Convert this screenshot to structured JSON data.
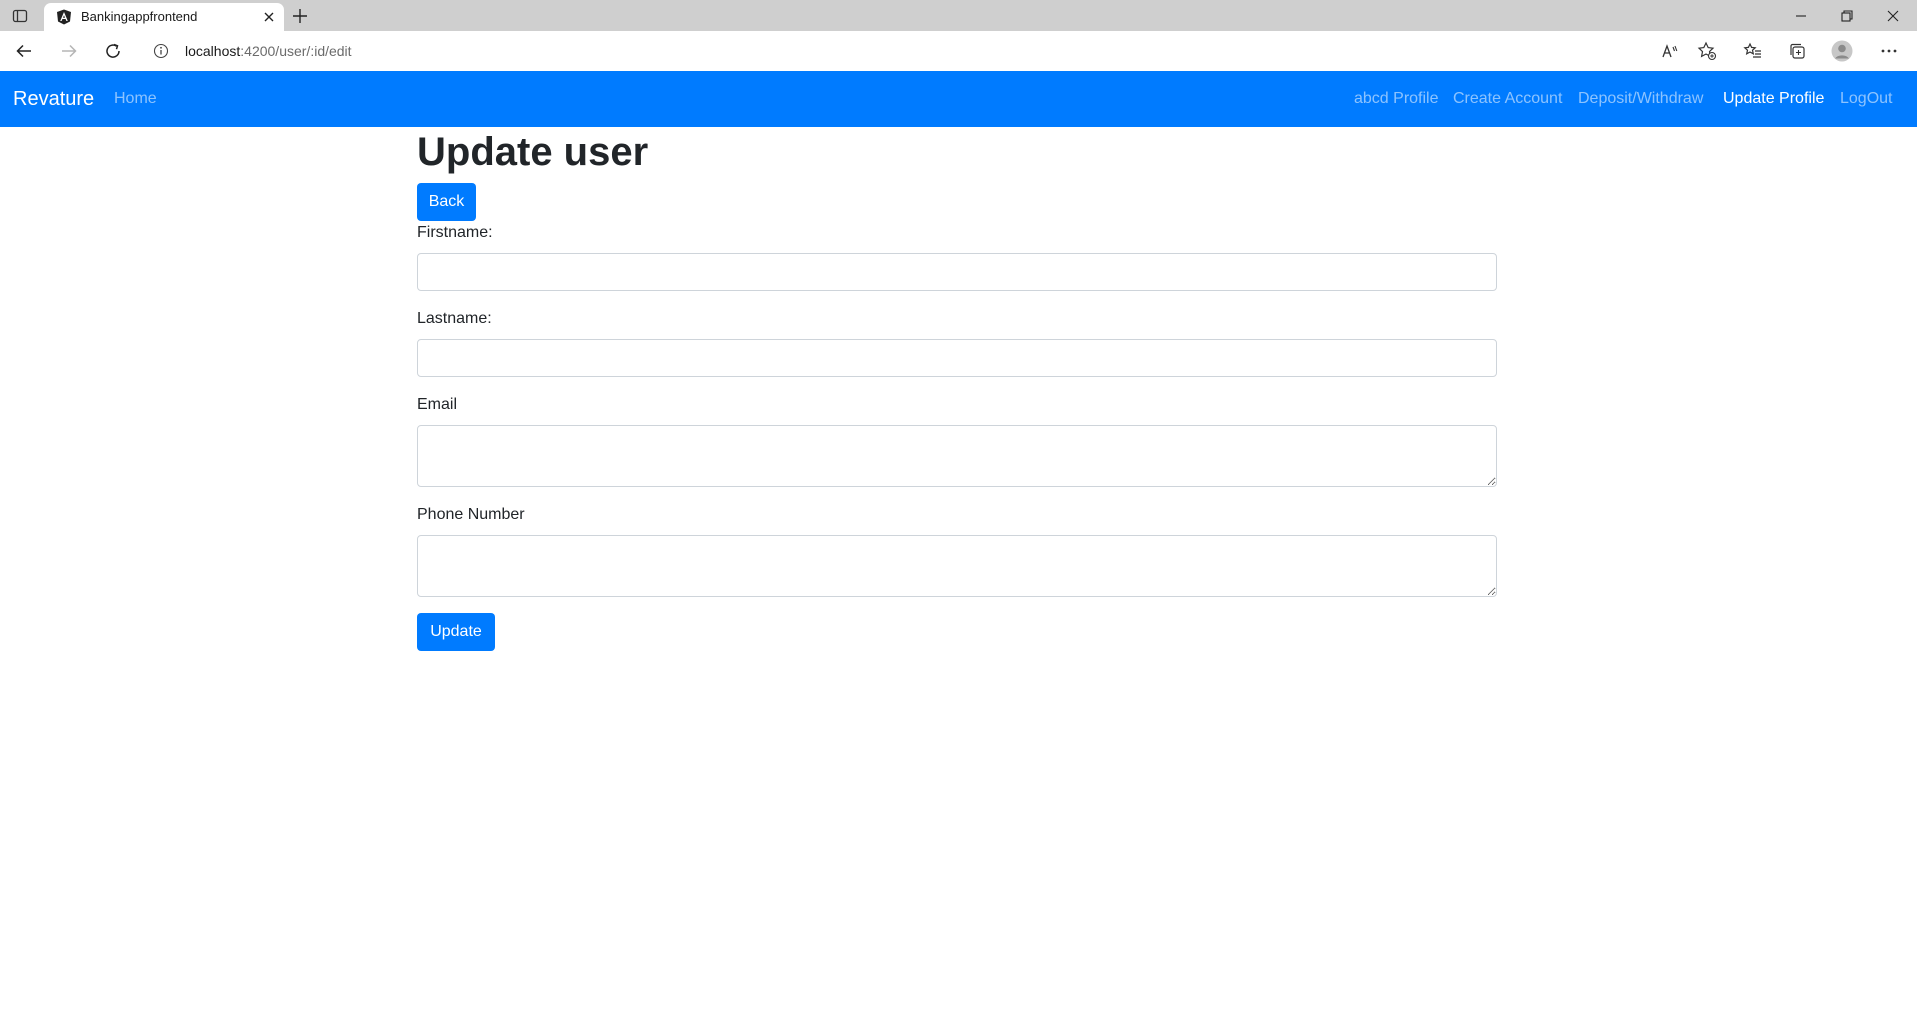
{
  "browser": {
    "tab_title": "Bankingappfrontend",
    "url_host": "localhost",
    "url_path": ":4200/user/:id/edit"
  },
  "navbar": {
    "brand": "Revature",
    "home": "Home",
    "links": [
      "abcd Profile",
      "Create Account",
      "Deposit/Withdraw",
      "Update Profile",
      "LogOut"
    ],
    "active_link": "Update Profile",
    "color": "#007bff"
  },
  "form": {
    "title": "Update user",
    "back_label": "Back",
    "firstname_label": "Firstname:",
    "firstname_value": "",
    "lastname_label": "Lastname:",
    "lastname_value": "",
    "email_label": "Email",
    "email_value": "",
    "phone_label": "Phone Number",
    "phone_value": "",
    "update_label": "Update"
  },
  "icons": [
    "sidebar-icon",
    "angular-icon",
    "close-icon",
    "plus-icon",
    "back-arrow-icon",
    "forward-arrow-icon",
    "refresh-icon",
    "info-icon",
    "read-aloud-icon",
    "add-favorite-icon",
    "favorites-icon",
    "collections-icon",
    "profile-icon",
    "more-icon",
    "minimize-icon",
    "restore-icon",
    "window-close-icon"
  ]
}
